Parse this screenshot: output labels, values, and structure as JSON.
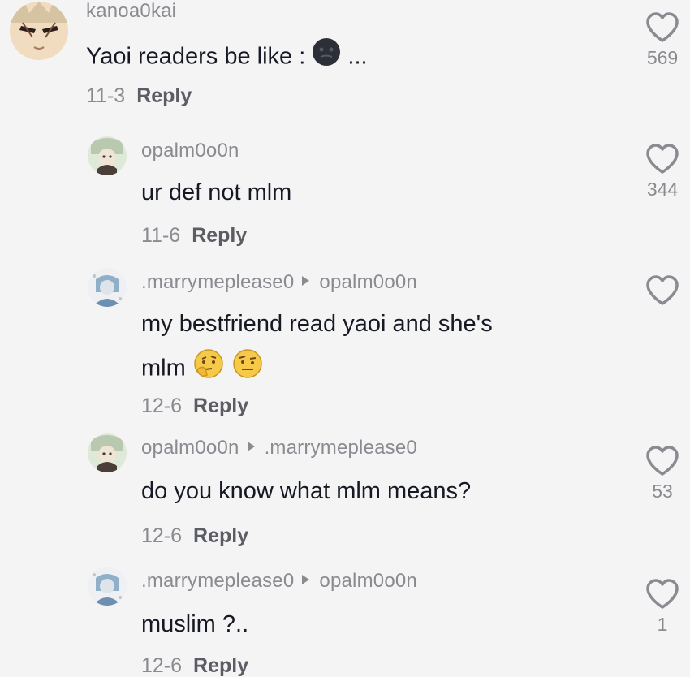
{
  "comments": [
    {
      "username": "kanoa0kai",
      "reply_to": "",
      "text_lines": [
        "Yaoi readers be like :"
      ],
      "text_suffix": "...",
      "date": "11-3",
      "reply_label": "Reply",
      "likes": "569"
    },
    {
      "username": "opalm0o0n",
      "reply_to": "",
      "text_lines": [
        "ur def not mlm"
      ],
      "date": "11-6",
      "reply_label": "Reply",
      "likes": "344"
    },
    {
      "username": ".marrymeplease0",
      "reply_to": "opalm0o0n",
      "text_lines": [
        "my bestfriend read yaoi and she's",
        "mlm"
      ],
      "date": "12-6",
      "reply_label": "Reply",
      "likes": ""
    },
    {
      "username": "opalm0o0n",
      "reply_to": ".marrymeplease0",
      "text_lines": [
        "do you know what mlm means?"
      ],
      "date": "12-6",
      "reply_label": "Reply",
      "likes": "53"
    },
    {
      "username": ".marrymeplease0",
      "reply_to": "opalm0o0n",
      "text_lines": [
        "muslim ?.."
      ],
      "date": "12-6",
      "reply_label": "Reply",
      "likes": "1"
    }
  ],
  "icons": {
    "like": "heart-outline-icon",
    "reply_arrow": "reply-to-arrow-icon",
    "emoji_1": "dark-face-emoji",
    "emoji_2": "thinking-face-emoji",
    "emoji_3": "raised-eyebrow-face-emoji"
  },
  "colors": {
    "background": "#f4f4f4",
    "username": "#8a8b91",
    "text": "#161823",
    "meta": "#8a8b91",
    "reply": "#5c5d64",
    "heart": "#8a8b91"
  }
}
